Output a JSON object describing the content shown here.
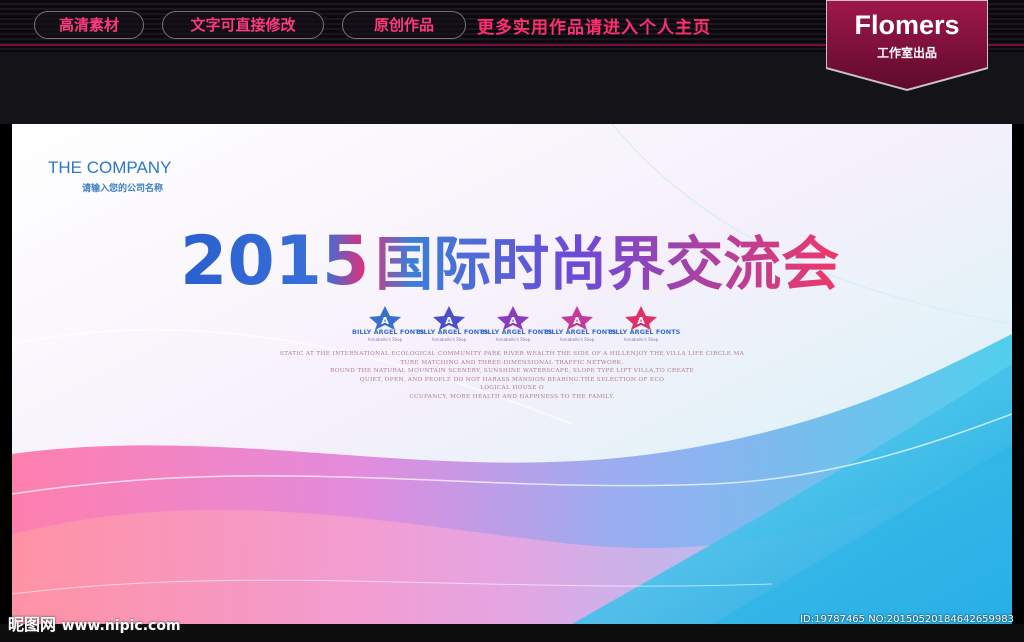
{
  "top_nav": {
    "buttons": [
      "高清素材",
      "文字可直接修改",
      "原创作品"
    ],
    "promo": "更多实用作品请进入个人主页"
  },
  "badge": {
    "title": "Flomers",
    "subtitle": "工作室出品"
  },
  "poster": {
    "company_name": "THE COMPANY",
    "company_tagline": "请输入您的公司名称",
    "headline_year": "2015",
    "headline_text": "国际时尚界交流会",
    "star_logos": [
      {
        "letter": "A",
        "brand": "BILLY ARGEL FONTS",
        "script": "Annabelle's Shop",
        "color": "#3a6fd0"
      },
      {
        "letter": "A",
        "brand": "BILLY ARGEL FONTS",
        "script": "Annabelle's Shop",
        "color": "#4b4fc8"
      },
      {
        "letter": "A",
        "brand": "BILLY ARGEL FONTS",
        "script": "Annabelle's Shop",
        "color": "#8a3cc0"
      },
      {
        "letter": "A",
        "brand": "BILLY ARGEL FONTS",
        "script": "Annabelle's Shop",
        "color": "#c23a9a"
      },
      {
        "letter": "A",
        "brand": "BILLY ARGEL FONTS",
        "script": "Annabelle's Shop",
        "color": "#e0306a"
      }
    ],
    "body_lines": [
      "STATIC AT THE INTERNATIONAL ECOLOGICAL COMMUNITY PARK RIVER WEALTH THE SIDE OF A HILLENJOY THE VILLA LIFE CIRCLE MA",
      "TURE MATCHING AND THREE-DIMENSIONAL TRAFFIC NETWORK.",
      "ROUND THE NATURAL MOUNTAIN SCENERY, SUNSHINE WATERSCAPE, SLOPE TYPE LIFT VILLA,TO CREATE",
      "QUIET, OPEN, AND PEOPLE DO NOT HARASS MANSION BEARING.THE SELECTION OF ECO",
      "LOGICAL HOUSE O",
      "CCUPANCY, MORE HEALTH AND HAPPINESS TO THE FAMILY."
    ]
  },
  "watermark": {
    "site_name": "昵图网",
    "site_url": "www.nipic.com",
    "id_text": "ID:19787465 NO:20150520184642659983"
  },
  "colors": {
    "accent_pink": "#ff2f6f",
    "blue": "#2a78c8",
    "badge_bg": "#8a1240"
  }
}
